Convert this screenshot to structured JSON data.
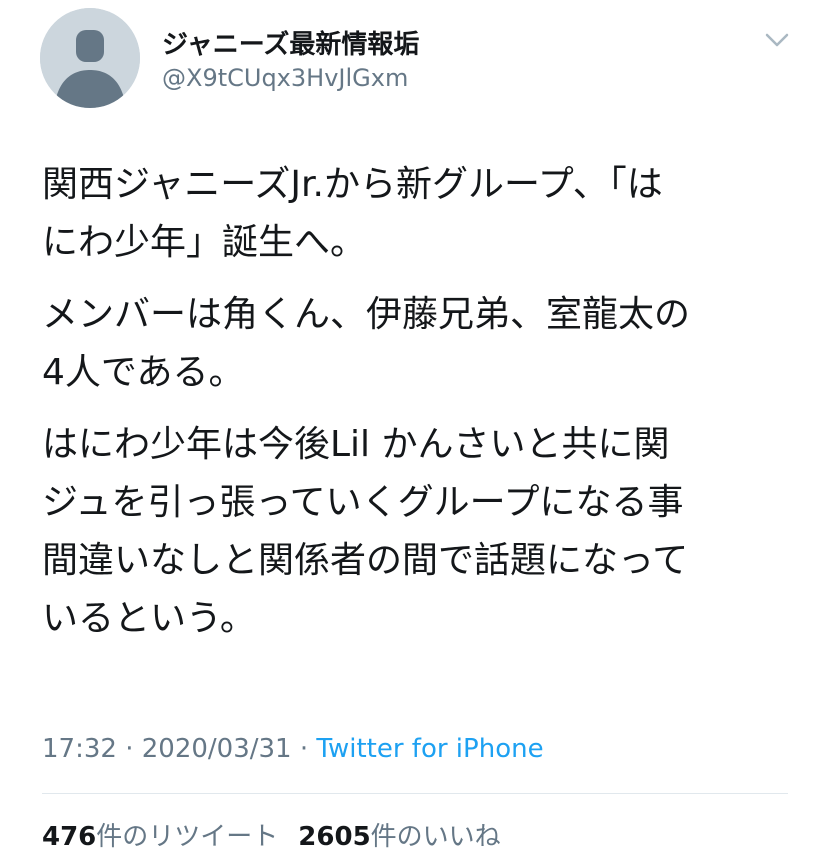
{
  "author": {
    "display_name": "ジャニーズ最新情報垢",
    "handle": "@X9tCUqx3HvJlGxm",
    "avatar_icon": "default-avatar-icon"
  },
  "menu_icon": "chevron-down-icon",
  "paragraphs": [
    "関西ジャニーズJr.から新グループ、「は\nにわ少年」誕生へ。",
    "メンバーは角くん、伊藤兄弟、室龍太の\n4人である。",
    "はにわ少年は今後Lil かんさいと共に関\nジュを引っ張っていくグループになる事\n間違いなしと関係者の間で話題になって\nいるという。"
  ],
  "meta": {
    "time": "17:32",
    "sep1": " · ",
    "date": "2020/03/31",
    "sep2": " · ",
    "source": "Twitter for iPhone"
  },
  "stats": {
    "retweets_count": "476",
    "retweets_label": "件のリツイート",
    "likes_count": "2605",
    "likes_label": "件のいいね"
  },
  "colors": {
    "text": "#14171a",
    "secondary": "#657786",
    "link": "#1da1f2",
    "avatar_bg": "#ccd6dd",
    "avatar_fg": "#657786"
  }
}
